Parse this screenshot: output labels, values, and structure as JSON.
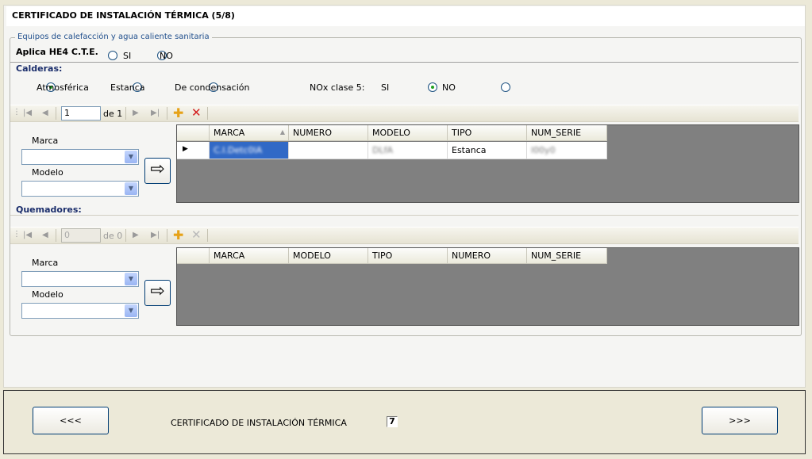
{
  "window": {
    "title": "CERTIFICADO DE INSTALACIÓN TÉRMICA (5/8)"
  },
  "group": {
    "legend": "Equipos de calefacción y agua caliente sanitaria"
  },
  "he4": {
    "label": "Aplica HE4 C.T.E.",
    "options": [
      "SI",
      "NO"
    ],
    "selected": "none"
  },
  "calderas": {
    "label": "Calderas:",
    "types": [
      "Atmosférica",
      "Estanca",
      "De condensación"
    ],
    "selected_type": "Atmosférica",
    "nox_label": "NOx clase 5:",
    "nox_options": [
      "SI",
      "NO"
    ],
    "nox_selected": "SI",
    "navigator": {
      "position": "1",
      "of": "de 1"
    },
    "marca_label": "Marca",
    "modelo_label": "Modelo",
    "grid": {
      "columns": [
        "MARCA",
        "NUMERO",
        "MODELO",
        "TIPO",
        "NUM_SERIE"
      ],
      "rows": [
        {
          "MARCA": "C.I.Detc0lA",
          "NUMERO": "",
          "MODELO": "DLfA",
          "TIPO": "Estanca",
          "NUM_SERIE": "l00y0"
        }
      ]
    }
  },
  "quemadores": {
    "label": "Quemadores:",
    "navigator": {
      "position": "0",
      "of": "de 0"
    },
    "marca_label": "Marca",
    "modelo_label": "Modelo",
    "grid": {
      "columns": [
        "MARCA",
        "MODELO",
        "TIPO",
        "NUMERO",
        "NUM_SERIE"
      ],
      "rows": []
    }
  },
  "footer": {
    "prev_label": "<<<",
    "next_label": ">>>",
    "center_label": "CERTIFICADO DE INSTALACIÓN TÉRMICA",
    "page_number": "7"
  },
  "colors": {
    "selected_cell": "#3169c6",
    "radio_on": "#21a121",
    "section_label": "#1a2d6b"
  }
}
